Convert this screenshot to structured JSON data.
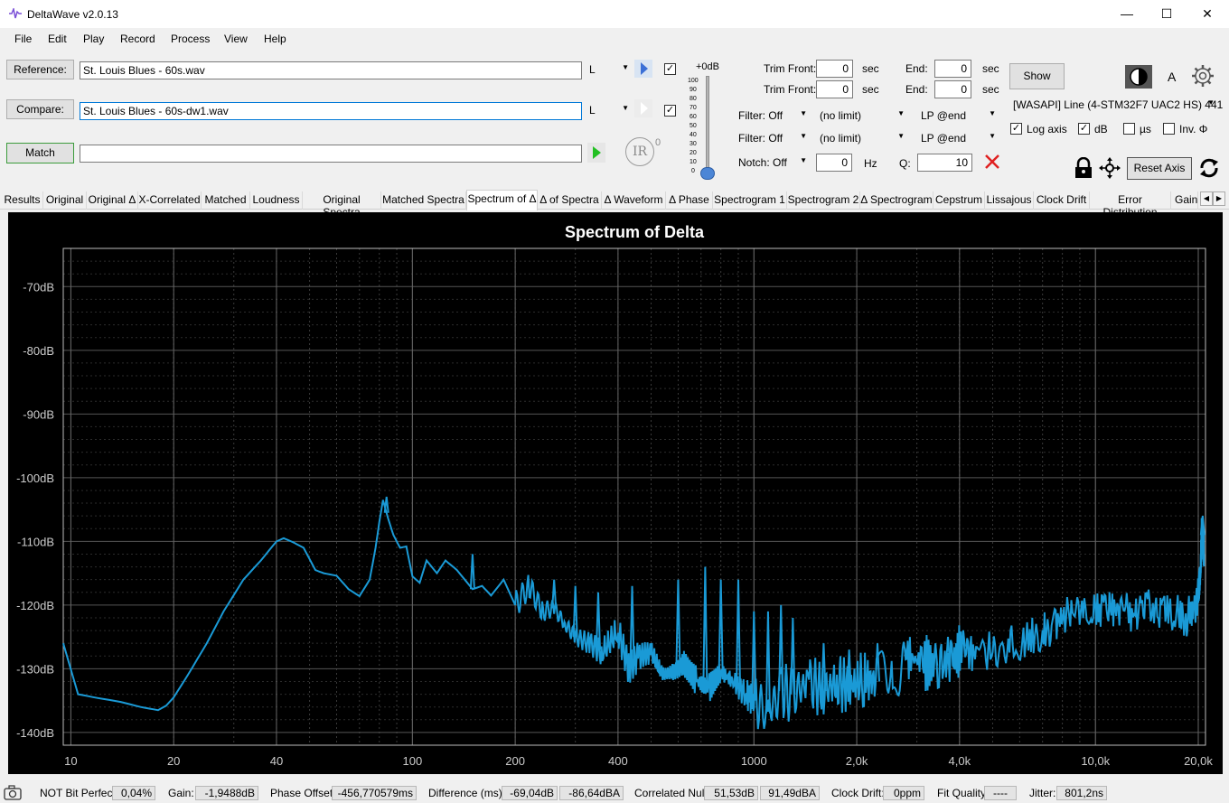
{
  "window": {
    "title": "DeltaWave v2.0.13",
    "minimize": "—",
    "maximize": "☐",
    "close": "✕"
  },
  "menu": [
    "File",
    "Edit",
    "Play",
    "Record",
    "Process",
    "View",
    "Help"
  ],
  "files": {
    "reference_label": "Reference:",
    "reference_value": "St. Louis Blues - 60s.wav",
    "reference_channel": "L",
    "compare_label": "Compare:",
    "compare_value": "St. Louis Blues - 60s-dw1.wav",
    "compare_channel": "L",
    "match_label": "Match",
    "match_value": "",
    "ir_label": "IR",
    "ir_sup": "0"
  },
  "level": {
    "label": "+0dB",
    "scale": [
      "100",
      "90",
      "80",
      "70",
      "60",
      "50",
      "40",
      "30",
      "20",
      "10",
      "0"
    ]
  },
  "trim": {
    "front_label": "Trim Front:",
    "end_label": "End:",
    "unit": "sec",
    "front1": "0",
    "end1": "0",
    "front2": "0",
    "end2": "0"
  },
  "filters": {
    "filter1": "Filter: Off",
    "limit1": "(no limit)",
    "lp1": "LP @end",
    "filter2": "Filter: Off",
    "limit2": "(no limit)",
    "lp2": "LP @end",
    "notch": "Notch: Off",
    "notch_value": "0",
    "hz_label": "Hz",
    "q_label": "Q:",
    "q_value": "10"
  },
  "right": {
    "show_label": "Show",
    "a_label": "A",
    "device": "[WASAPI] Line (4-STM32F7 UAC2 HS) 441",
    "log_axis": "Log axis",
    "db": "dB",
    "us": "µs",
    "inv": "Inv. Φ",
    "reset_axis": "Reset Axis"
  },
  "tabs": [
    "Results",
    "Original",
    "Original Δ",
    "X-Correlated",
    "Matched",
    "Loudness",
    "Original Spectra",
    "Matched Spectra",
    "Spectrum of Δ",
    "Δ of Spectra",
    "Δ Waveform",
    "Δ Phase",
    "Spectrogram 1",
    "Spectrogram 2",
    "Δ Spectrogram",
    "Cepstrum",
    "Lissajous",
    "Clock Drift",
    "Error Distribution",
    "Gain"
  ],
  "active_tab": "Spectrum of Δ",
  "chart_data": {
    "type": "line",
    "title": "Spectrum of Delta",
    "xscale": "log",
    "xlim": [
      9.5,
      21000
    ],
    "ylim": [
      -142,
      -64
    ],
    "x_ticks": [
      10,
      20,
      40,
      100,
      200,
      400,
      1000,
      2000,
      4000,
      10000,
      20000
    ],
    "x_tick_labels": [
      "10",
      "20",
      "40",
      "100",
      "200",
      "400",
      "1000",
      "2,0k",
      "4,0k",
      "10,0k",
      "20,0k"
    ],
    "y_ticks": [
      -70,
      -80,
      -90,
      -100,
      -110,
      -120,
      -130,
      -140
    ],
    "y_tick_labels": [
      "-70dB",
      "-80dB",
      "-90dB",
      "-100dB",
      "-110dB",
      "-120dB",
      "-130dB",
      "-140dB"
    ],
    "grid": true,
    "line_color": "#1a9ad6",
    "x": [
      9.5,
      10.5,
      12,
      14,
      16,
      18,
      19,
      20,
      22,
      25,
      28,
      32,
      36,
      40,
      42,
      45,
      48,
      52,
      55,
      60,
      65,
      70,
      75,
      78,
      80,
      82,
      85,
      88,
      92,
      96,
      100,
      105,
      110,
      118,
      125,
      135,
      150,
      160,
      170,
      185,
      200,
      220,
      240,
      260,
      280,
      300,
      330,
      360,
      400,
      430,
      460,
      500,
      540,
      580,
      620,
      680,
      740,
      800,
      870,
      950,
      1000,
      1100,
      1200,
      1300,
      1450,
      1600,
      1750,
      1900,
      2100,
      2300,
      2550,
      2800,
      3100,
      3400,
      3800,
      4100,
      4500,
      5000,
      5600,
      6200,
      7000,
      7700,
      8500,
      9500,
      10500,
      11500,
      12700,
      14000,
      15500,
      17000,
      18500,
      19500,
      20000,
      20300,
      20500,
      20800
    ],
    "y": [
      -126,
      -134,
      -134.6,
      -135.2,
      -136,
      -136.5,
      -135.8,
      -134.5,
      -131,
      -126,
      -121,
      -116,
      -113,
      -110,
      -109.5,
      -110.2,
      -111,
      -114.5,
      -115,
      -115.4,
      -117.5,
      -118.6,
      -116,
      -111,
      -107,
      -103.5,
      -106.5,
      -109,
      -111,
      -110.8,
      -115.5,
      -116.5,
      -113,
      -115,
      -113,
      -114.5,
      -117.5,
      -117,
      -118.5,
      -116,
      -120,
      -117,
      -121,
      -120.5,
      -123,
      -125,
      -126,
      -127.5,
      -124,
      -130,
      -128,
      -127.5,
      -131,
      -130.5,
      -129,
      -132,
      -133,
      -130.5,
      -132,
      -134,
      -135,
      -137,
      -133.5,
      -134,
      -132,
      -133.5,
      -132,
      -133,
      -131.5,
      -132,
      -131,
      -128,
      -129,
      -129.5,
      -129,
      -126.5,
      -128,
      -127,
      -126,
      -125.5,
      -124.5,
      -122.5,
      -121,
      -120.5,
      -121,
      -120.5,
      -121.5,
      -120.8,
      -120.6,
      -121.2,
      -122,
      -120.5,
      -118,
      -115,
      -107.5,
      -112
    ],
    "spikes": [
      [
        84,
        -103
      ],
      [
        150,
        -112
      ],
      [
        260,
        -116
      ],
      [
        300,
        -117
      ],
      [
        350,
        -118
      ],
      [
        440,
        -117
      ],
      [
        600,
        -116
      ],
      [
        720,
        -114
      ],
      [
        800,
        -116
      ],
      [
        900,
        -116
      ],
      [
        1000,
        -121
      ],
      [
        1100,
        -121
      ],
      [
        1200,
        -120
      ],
      [
        1300,
        -122
      ],
      [
        1600,
        -126
      ],
      [
        1900,
        -127
      ],
      [
        2300,
        -126
      ],
      [
        2800,
        -127
      ],
      [
        3400,
        -126
      ],
      [
        3700,
        -125
      ],
      [
        4100,
        -124
      ],
      [
        20600,
        -106
      ]
    ]
  },
  "status": {
    "bitperfect_label": "NOT Bit Perfect",
    "bitperfect_value": "0,04%",
    "gain_label": "Gain:",
    "gain_value": "-1,9488dB",
    "phase_label": "Phase Offset:",
    "phase_value": "-456,770579ms",
    "diff_label": "Difference (ms):",
    "diff_value1": "-69,04dB",
    "diff_value2": "-86,64dBA",
    "null_label": "Correlated Null:",
    "null_value1": "51,53dB",
    "null_value2": "91,49dBA",
    "drift_label": "Clock Drift:",
    "drift_value": "0ppm",
    "fit_label": "Fit Quality:",
    "fit_value": "----",
    "jitter_label": "Jitter:",
    "jitter_value": "801,2ns"
  }
}
